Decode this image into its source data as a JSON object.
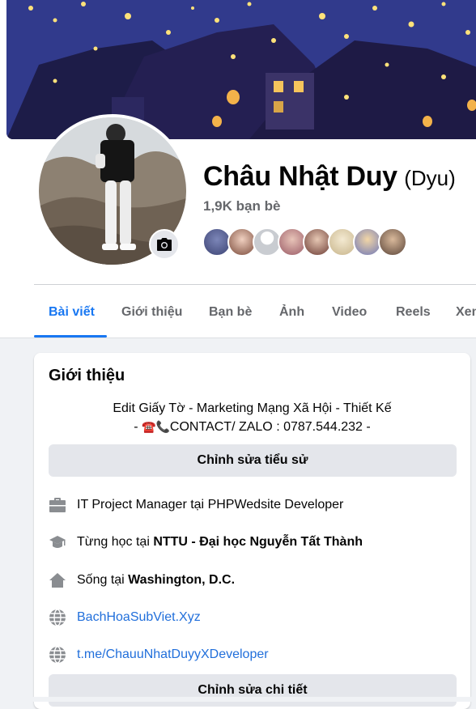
{
  "profile": {
    "name": "Châu Nhật Duy",
    "nickname": "(Dyu)",
    "friends_count": "1,9K bạn bè"
  },
  "tabs": [
    {
      "label": "Bài viết",
      "active": true
    },
    {
      "label": "Giới thiệu"
    },
    {
      "label": "Bạn bè"
    },
    {
      "label": "Ảnh"
    },
    {
      "label": "Video"
    },
    {
      "label": "Reels"
    },
    {
      "label": "Xem"
    }
  ],
  "intro": {
    "title": "Giới thiệu",
    "bio_line1": "Edit Giấy Tờ - Marketing Mạng Xã Hội - Thiết Kế",
    "bio_line2_prefix": "- ",
    "bio_emoji": "☎️📞",
    "bio_line2_text": "CONTACT/ ZALO : 0787.544.232 -",
    "edit_bio_label": "Chỉnh sửa tiểu sử",
    "work": {
      "prefix": "IT Project Manager tại ",
      "place": "PHPWedsite Developer"
    },
    "education": {
      "prefix": "Từng học tại ",
      "place": "NTTU - Đại học Nguyễn Tất Thành"
    },
    "location": {
      "prefix": "Sống tại ",
      "place": "Washington, D.C."
    },
    "website1": "BachHoaSubViet.Xyz",
    "website2": "t.me/ChauuNhatDuyyXDeveloper",
    "edit_details_label": "Chỉnh sửa chi tiết"
  },
  "colors": {
    "accent": "#1877f2",
    "link": "#216fdb",
    "muted": "#65676b"
  }
}
